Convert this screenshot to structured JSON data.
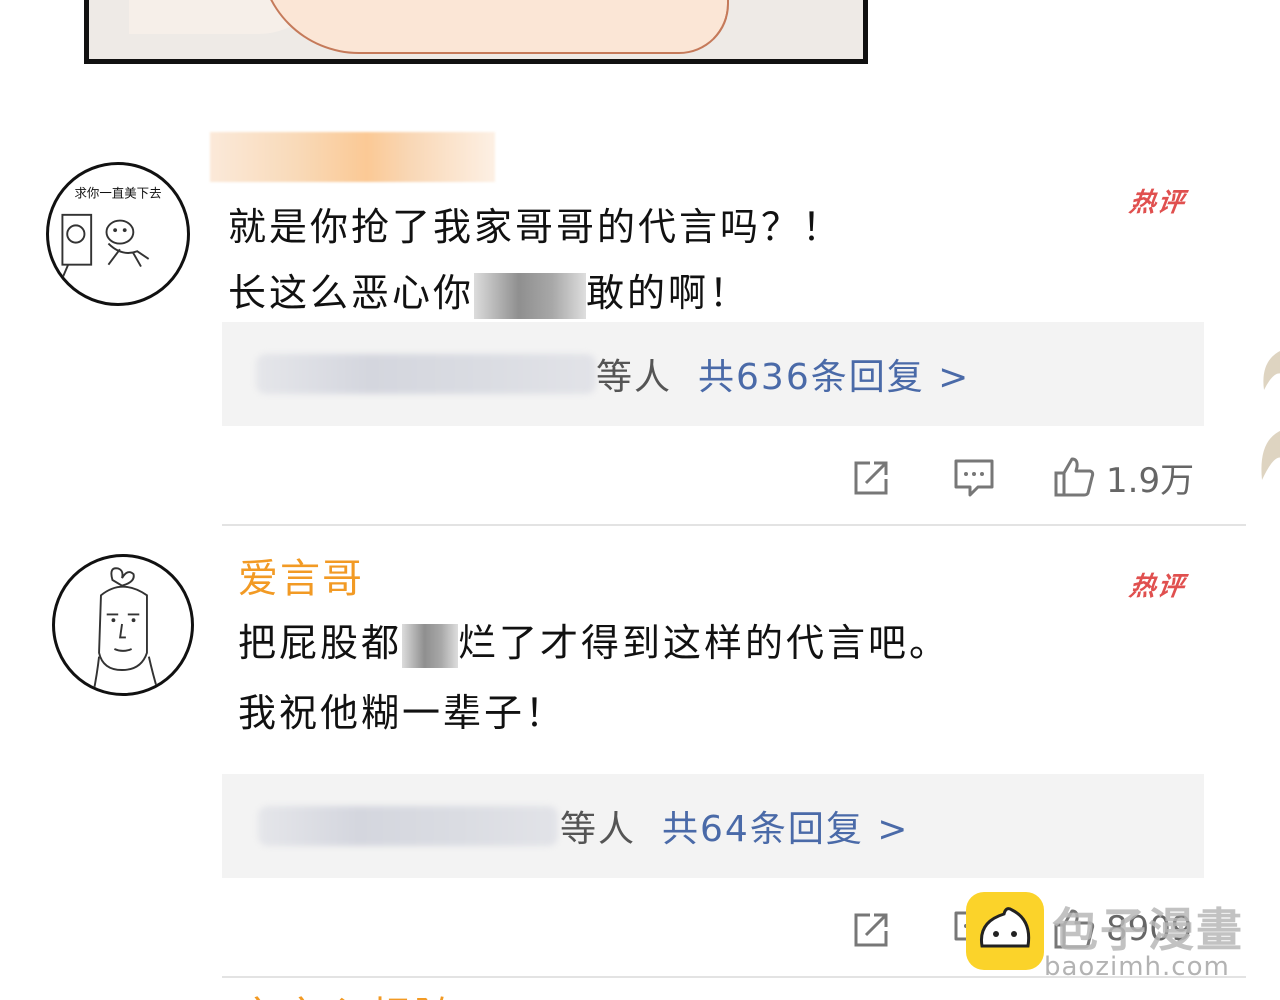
{
  "comments": [
    {
      "username": "",
      "avatar_caption": "求你一直美下去",
      "hot_label": "热评",
      "line1": "就是你抢了我家哥哥的代言吗？！",
      "line2_before": "长这么恶心你",
      "line2_after": "敢的啊！",
      "reply_who": "等人",
      "reply_count": "共636条回复 >",
      "likes": "1.9万"
    },
    {
      "username": "爱言哥",
      "hot_label": "热评",
      "line1_before": "把屁股都",
      "line1_after": "烂了才得到这样的代言吧。",
      "line2": "我祝他糊一辈子！",
      "reply_who": "等人",
      "reply_count": "共64条回复 >",
      "likes": "8909"
    }
  ],
  "next_username_partial": "言言心相随",
  "watermark": {
    "title": "包子漫畫",
    "url": "baozimh.com"
  },
  "colors": {
    "username": "#f29a24",
    "hot_badge": "#e0504f",
    "reply_link": "#4a6aa8",
    "reply_box_bg": "#f3f3f3"
  },
  "icons": [
    "share-icon",
    "comment-icon",
    "like-icon"
  ]
}
